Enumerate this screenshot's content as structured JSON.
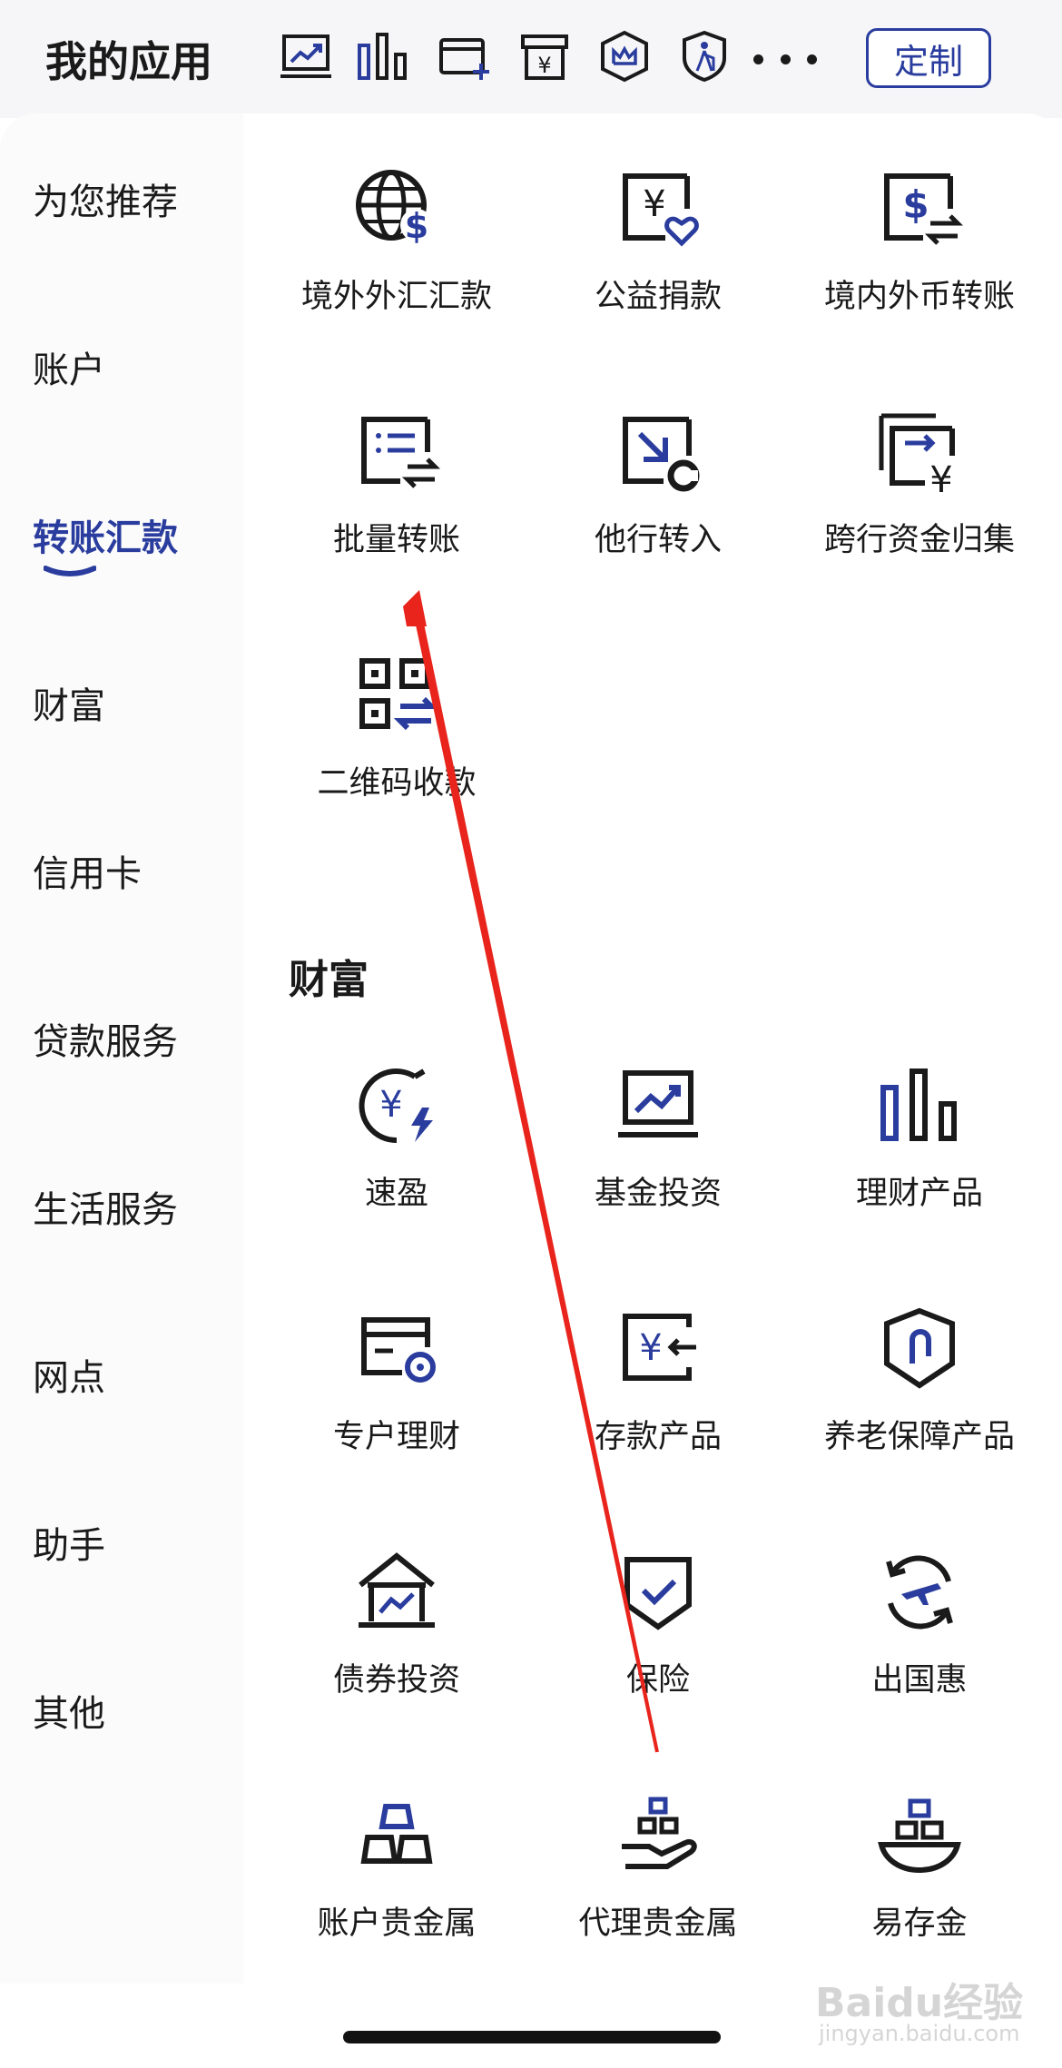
{
  "header": {
    "title": "我的应用",
    "shortcuts": [
      {
        "icon": "fund-chart-icon"
      },
      {
        "icon": "bar-chart-icon"
      },
      {
        "icon": "card-add-icon"
      },
      {
        "icon": "yuan-box-icon"
      },
      {
        "icon": "crown-shield-icon"
      },
      {
        "icon": "elder-shield-icon"
      }
    ],
    "more_icon": "more-dots-icon",
    "customize_label": "定制"
  },
  "sidebar": {
    "items": [
      {
        "label": "为您推荐"
      },
      {
        "label": "账户"
      },
      {
        "label": "转账汇款",
        "active": true
      },
      {
        "label": "财富"
      },
      {
        "label": "信用卡"
      },
      {
        "label": "贷款服务"
      },
      {
        "label": "生活服务"
      },
      {
        "label": "网点"
      },
      {
        "label": "助手"
      },
      {
        "label": "其他"
      }
    ]
  },
  "transfer": {
    "items": [
      {
        "label": "境外外汇汇款",
        "icon": "globe-dollar-icon"
      },
      {
        "label": "公益捐款",
        "icon": "yuan-heart-icon"
      },
      {
        "label": "境内外币转账",
        "icon": "dollar-transfer-icon"
      },
      {
        "label": "批量转账",
        "icon": "batch-list-icon"
      },
      {
        "label": "他行转入",
        "icon": "arrow-in-icon"
      },
      {
        "label": "跨行资金归集",
        "icon": "yuan-collect-icon"
      },
      {
        "label": "二维码收款",
        "icon": "qr-code-icon"
      }
    ]
  },
  "wealth": {
    "title": "财富",
    "items": [
      {
        "label": "速盈",
        "icon": "yuan-lightning-icon"
      },
      {
        "label": "基金投资",
        "icon": "fund-chart-icon"
      },
      {
        "label": "理财产品",
        "icon": "bar-chart-icon"
      },
      {
        "label": "专户理财",
        "icon": "card-coin-icon"
      },
      {
        "label": "存款产品",
        "icon": "yuan-deposit-icon"
      },
      {
        "label": "养老保障产品",
        "icon": "pension-shield-icon"
      },
      {
        "label": "债券投资",
        "icon": "bond-house-icon"
      },
      {
        "label": "保险",
        "icon": "check-shield-icon"
      },
      {
        "label": "出国惠",
        "icon": "plane-cycle-icon"
      },
      {
        "label": "账户贵金属",
        "icon": "gold-bars-icon"
      },
      {
        "label": "代理贵金属",
        "icon": "gold-hand-icon"
      },
      {
        "label": "易存金",
        "icon": "gold-bowl-icon"
      }
    ]
  },
  "colors": {
    "accent": "#2a3d9e",
    "text": "#1a1a1a",
    "annotation": "#e8241c"
  },
  "watermark": {
    "brand": "Baidu经验",
    "url": "jingyan.baidu.com"
  }
}
